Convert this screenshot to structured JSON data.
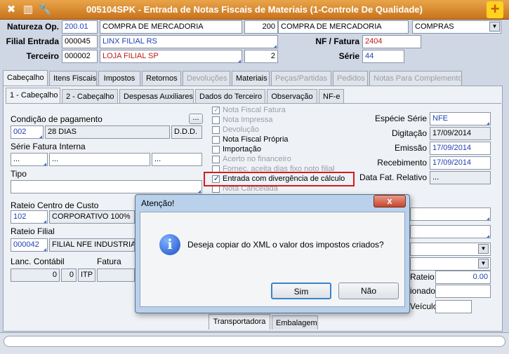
{
  "window": {
    "title": "005104SPK - Entrada de Notas Fiscais de Materiais (1-Controle De Qualidade)",
    "add_icon": "+"
  },
  "header": {
    "natureza_label": "Natureza Op.",
    "natureza_code": "200.01",
    "natureza_desc": "COMPRA DE MERCADORIA",
    "natureza_num": "200",
    "natureza_desc2": "COMPRA DE MERCADORIA",
    "natureza_tipo": "COMPRAS",
    "filial_label": "Filial Entrada",
    "filial_code": "000045",
    "filial_name": "LINX FILIAL RS",
    "terceiro_label": "Terceiro",
    "terceiro_code": "000002",
    "terceiro_name": "LOJA FILIAL SP",
    "terceiro_num": "2",
    "nf_label": "NF / Fatura",
    "nf_value": "2404",
    "serie_label": "Série",
    "serie_value": "44"
  },
  "main_tabs": [
    {
      "label": "Cabeçalho"
    },
    {
      "label": "Itens Fiscais"
    },
    {
      "label": "Impostos"
    },
    {
      "label": "Retornos"
    },
    {
      "label": "Devoluções"
    },
    {
      "label": "Materiais"
    },
    {
      "label": "Peças/Partidas"
    },
    {
      "label": "Pedidos"
    },
    {
      "label": "Notas Para Complemento"
    }
  ],
  "sub_tabs": [
    {
      "label": "1 - Cabeçalho"
    },
    {
      "label": "2 - Cabeçalho"
    },
    {
      "label": "Despesas Auxiliares"
    },
    {
      "label": "Dados do Terceiro"
    },
    {
      "label": "Observação"
    },
    {
      "label": "NF-e"
    }
  ],
  "left": {
    "cond_label": "Condição de pagamento",
    "ellipsis": "...",
    "cond_code": "002",
    "cond_desc": "28 DIAS",
    "cond_ddd": "D.D.D.",
    "serie_fatura_label": "Série Fatura Interna",
    "sf1": "...",
    "sf2": "...",
    "sf3": "...",
    "tipo_label": "Tipo",
    "rateio_cc_label": "Rateio Centro de Custo",
    "rateio_cc_code": "102",
    "rateio_cc_desc": "CORPORATIVO 100%",
    "rateio_filial_label": "Rateio Filial",
    "rateio_filial_code": "000042",
    "rateio_filial_desc": "FILIAL NFE INDUSTRIAL",
    "lanc_label": "Lanc. Contábil",
    "fatura_label": "Fatura",
    "lanc_v1": "0",
    "lanc_v2": "0",
    "lanc_v3": "ITP"
  },
  "checks": [
    {
      "label": "Nota Fiscal Fatura",
      "checked": true,
      "disabled": true
    },
    {
      "label": "Nota Impressa",
      "checked": false,
      "disabled": true
    },
    {
      "label": "Devolução",
      "checked": false,
      "disabled": true
    },
    {
      "label": "Nota Fiscal Própria",
      "checked": false,
      "disabled": false
    },
    {
      "label": "Importação",
      "checked": false,
      "disabled": false
    },
    {
      "label": "Acerto no financeiro",
      "checked": false,
      "disabled": true
    },
    {
      "label": "Fornec. aceita dias fixo noto filial",
      "checked": false,
      "disabled": true
    },
    {
      "label": "Entrada com divergência de cálculo",
      "checked": true,
      "disabled": false
    },
    {
      "label": "Nota Cancelada",
      "checked": false,
      "disabled": true
    }
  ],
  "right": {
    "especie_label": "Espécie Série",
    "especie_value": "NFE",
    "digitacao_label": "Digitação",
    "digitacao_value": "17/09/2014",
    "emissao_label": "Emissão",
    "emissao_value": "17/09/2014",
    "recebimento_label": "Recebimento",
    "recebimento_value": "17/09/2014",
    "datafat_label": "Data Fat. Relativo",
    "datafat_value": "...",
    "rateio_label": "Rateio",
    "rateio_value": "0.00",
    "ionado_label": "ionado",
    "veiculo_label": "Veículo"
  },
  "bottom_tabs": [
    {
      "label": "Transportadora"
    },
    {
      "label": "Embalagem"
    }
  ],
  "dialog": {
    "title": "Atenção!",
    "close": "x",
    "message": "Deseja copiar do XML o valor dos impostos criados?",
    "info_glyph": "i",
    "yes": "Sim",
    "no": "Não"
  }
}
